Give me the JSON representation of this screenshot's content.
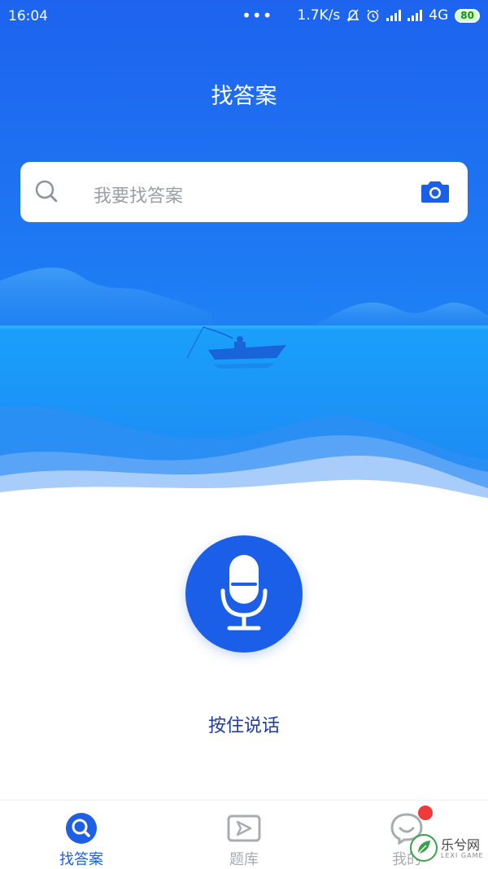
{
  "status_bar": {
    "time": "16:04",
    "more": "•••",
    "net_speed": "1.7K/s",
    "icons": [
      "mute-bell-icon",
      "alarm-icon",
      "signal-icon",
      "hd-signal-icon"
    ],
    "network": "4G",
    "battery": "80"
  },
  "header": {
    "title": "找答案"
  },
  "search": {
    "placeholder": "我要找答案",
    "icon": "search-icon",
    "camera_icon": "camera-icon"
  },
  "voice": {
    "icon": "microphone-icon",
    "label": "按住说话"
  },
  "tabs": [
    {
      "label": "找答案",
      "icon": "search-tab-icon",
      "active": true
    },
    {
      "label": "题库",
      "icon": "question-bank-icon",
      "active": false
    },
    {
      "label": "我的",
      "icon": "profile-chat-icon",
      "active": false,
      "badge": true
    }
  ],
  "watermark": {
    "name": "乐兮网",
    "sub": "LEXI GAME"
  },
  "colors": {
    "primary": "#1b5fe9",
    "active_tab": "#1d5fe5",
    "inactive_tab": "#a8acb2",
    "badge": "#f03a3a"
  }
}
